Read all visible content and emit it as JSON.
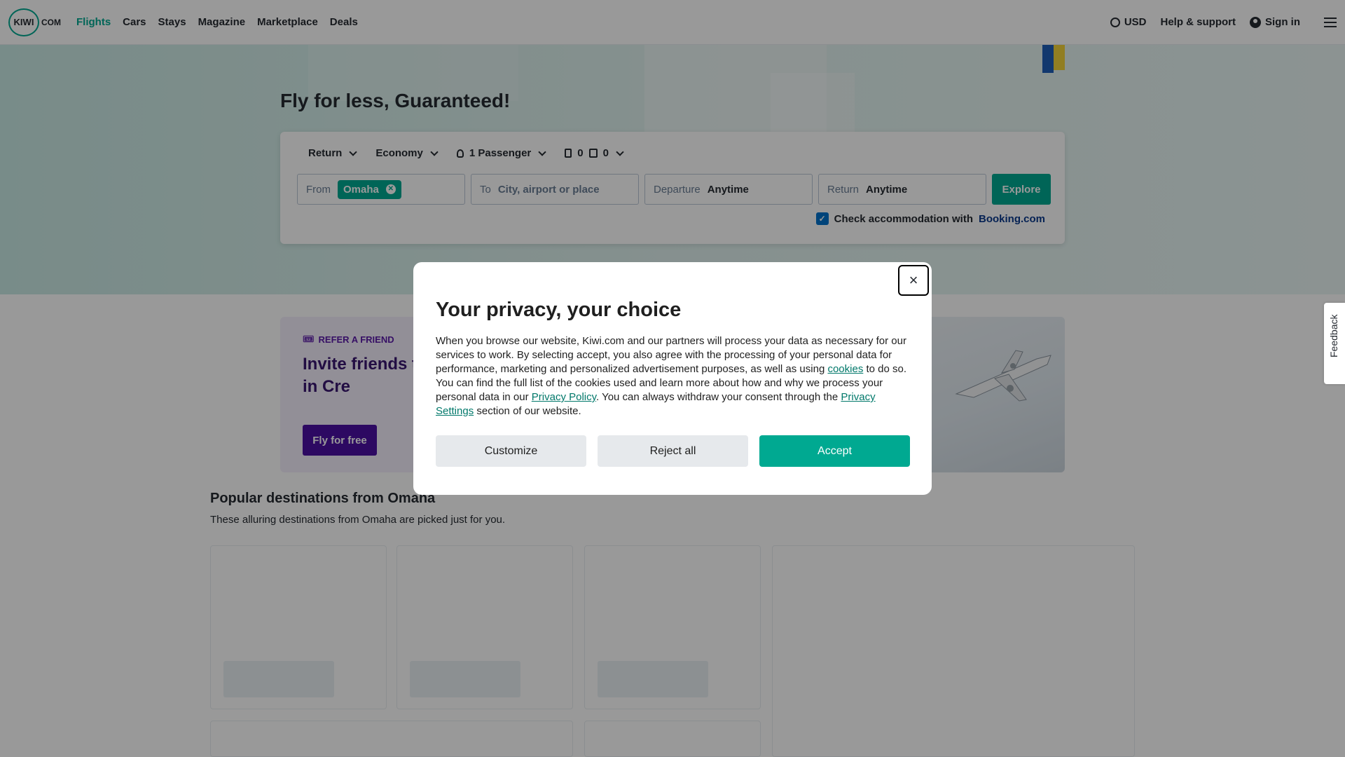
{
  "nav": {
    "logo_primary": "KIWI",
    "logo_suffix": "COM",
    "links": [
      "Flights",
      "Cars",
      "Stays",
      "Magazine",
      "Marketplace",
      "Deals"
    ],
    "active_link": "Flights",
    "currency": "USD",
    "help": "Help & support",
    "signin": "Sign in"
  },
  "hero": {
    "title": "Fly for less, Guaranteed!"
  },
  "search": {
    "trip_type": "Return",
    "cabin": "Economy",
    "passengers": "1 Passenger",
    "cabin_bags": "0",
    "checked_bags": "0",
    "from_label": "From",
    "from_value": "Omaha",
    "to_label": "To",
    "to_placeholder": "City, airport or place",
    "departure_label": "Departure",
    "departure_value": "Anytime",
    "return_label": "Return",
    "return_value": "Anytime",
    "explore": "Explore",
    "accommodation_text": "Check accommodation with",
    "accommodation_brand": "Booking.com",
    "accommodation_checked": true
  },
  "refer": {
    "tag": "REFER A FRIEND",
    "title": "Invite friends t to $500 in Cre",
    "button": "Fly for free"
  },
  "popular": {
    "title": "Popular destinations from Omaha",
    "subtitle": "These alluring destinations from Omaha are picked just for you."
  },
  "feedback": "Feedback",
  "modal": {
    "title": "Your privacy, your choice",
    "body_1": "When you browse our website, Kiwi.com and our partners will process your data as necessary for our services to work. By selecting accept, you also agree with the processing of your personal data for performance, marketing and personalized advertisement purposes, as well as using ",
    "link_cookies": "cookies",
    "body_2": " to do so. You can find the full list of the cookies used and learn more about how and why we process your personal data in our ",
    "link_privacy_policy": "Privacy Policy",
    "body_3": ". You can always withdraw your consent through the ",
    "link_privacy_settings": "Privacy Settings",
    "body_4": " section of our website.",
    "close": "×",
    "customize": "Customize",
    "reject": "Reject all",
    "accept": "Accept"
  },
  "colors": {
    "brand": "#00a991",
    "refer_button": "#4b0fa4",
    "checkbox": "#0172cb"
  }
}
